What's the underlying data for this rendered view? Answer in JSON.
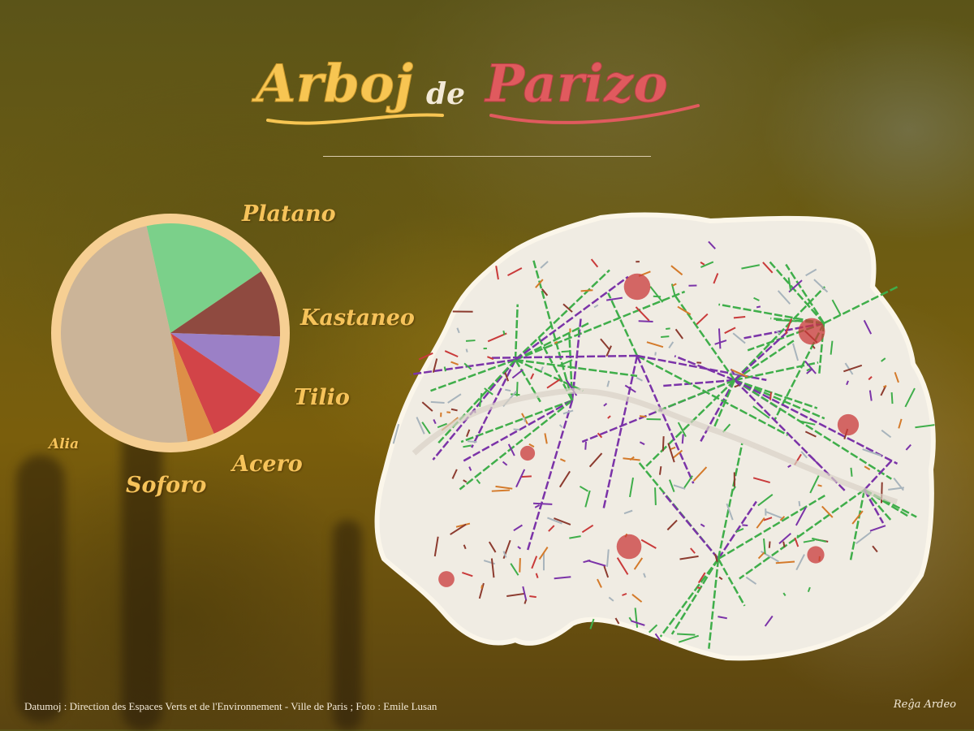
{
  "title": {
    "part1": "Arboj",
    "part2": "de",
    "part3": "Parizo",
    "colors": {
      "part1": "#f7c552",
      "part2": "#f3ead8",
      "part3": "#e05a5e"
    }
  },
  "chart_data": {
    "type": "pie",
    "title": "",
    "slices": [
      {
        "label": "Platano",
        "value": 19,
        "color": "#7bd08a"
      },
      {
        "label": "Kastaneo",
        "value": 10,
        "color": "#8f4a40"
      },
      {
        "label": "Tilio",
        "value": 9,
        "color": "#9b80c6"
      },
      {
        "label": "Acero",
        "value": 9,
        "color": "#d24448"
      },
      {
        "label": "Soforo",
        "value": 4,
        "color": "#dd8f47"
      },
      {
        "label": "Alia",
        "value": 49,
        "color": "#cbb498"
      }
    ],
    "start": "top",
    "direction": "clockwise",
    "rim_color": "#f6cf93"
  },
  "map": {
    "name": "Paris tree map",
    "line_colors": [
      "#3fae4a",
      "#7b33a8",
      "#d47a2a",
      "#8c3b2f",
      "#a8b4bc",
      "#c93a3a"
    ]
  },
  "footer": {
    "credit": "Datumoj : Direction des Espaces Verts et de l'Environnement - Ville de Paris ; Foto : Emile Lusan",
    "signature": "Reĝa Ardeo"
  }
}
